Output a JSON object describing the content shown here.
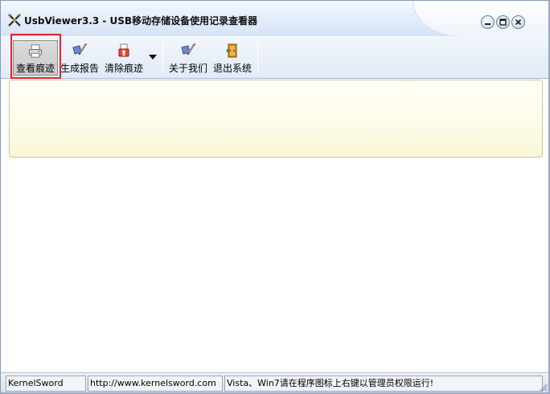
{
  "window": {
    "title": "UsbViewer3.3 - USB移动存储设备使用记录查看器"
  },
  "toolbar": {
    "buttons": [
      {
        "label": "查看痕迹",
        "icon": "printer-icon",
        "active": true
      },
      {
        "label": "生成报告",
        "icon": "report-pen-icon"
      },
      {
        "label": "清除痕迹",
        "icon": "clear-traces-icon",
        "has_dropdown": true
      },
      {
        "label": "关于我们",
        "icon": "about-pen-icon"
      },
      {
        "label": "退出系统",
        "icon": "exit-door-icon"
      }
    ]
  },
  "statusbar": {
    "company": "KernelSword",
    "website": "http://www.kernelsword.com",
    "tip": "Vista、Win7请在程序图标上右键以管理员权限运行!"
  },
  "colors": {
    "highlight": "#e4232b",
    "panel_bg": "#fdfbe6",
    "toolbar_bg": "#e2eaf6"
  }
}
